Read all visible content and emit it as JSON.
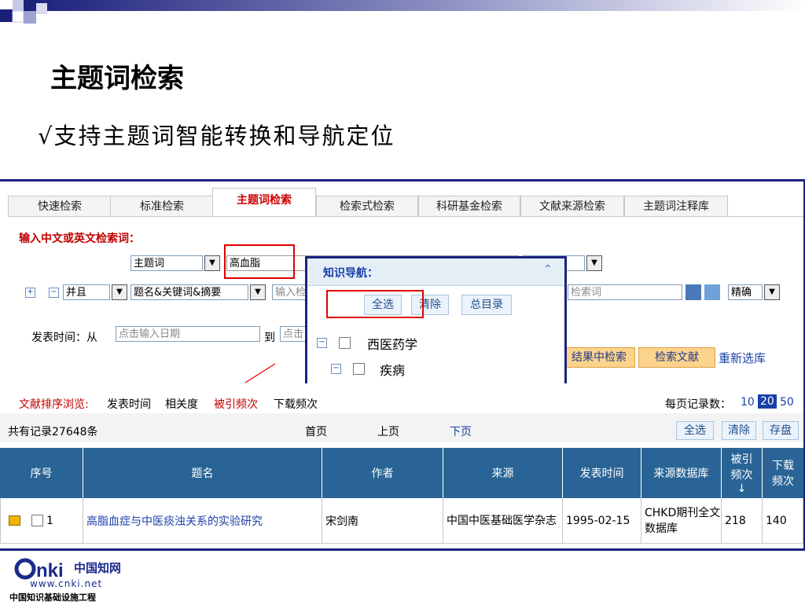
{
  "slide": {
    "title": "主题词检索",
    "subtitle": "√支持主题词智能转换和导航定位"
  },
  "tabs": [
    {
      "label": "快速检索",
      "active": false
    },
    {
      "label": "标准检索",
      "active": false
    },
    {
      "label": "主题词检索",
      "active": true
    },
    {
      "label": "检索式检索",
      "active": false
    },
    {
      "label": "科研基金检索",
      "active": false
    },
    {
      "label": "文献来源检索",
      "active": false
    },
    {
      "label": "主题词注释库",
      "active": false
    }
  ],
  "search": {
    "prompt": "输入中文或英文检索词：",
    "field_select": "主题词",
    "term_value": "高血脂",
    "logic_select": "并且",
    "field2_select": "题名&关键词&摘要",
    "input2_placeholder": "输入检",
    "keyword_placeholder": "检索词",
    "precision_select": "精确",
    "date_label": "发表时间：从",
    "date_from_placeholder": "点击输入日期",
    "date_to_label": "到",
    "date_to_placeholder": "点击",
    "btn_in_results": "结果中检索",
    "btn_search": "检索文献",
    "reselect_link": "重新选库"
  },
  "knowledge_nav": {
    "title": "知识导航：",
    "btn_select_all": "全选",
    "btn_clear": "清除",
    "btn_catalog": "总目录",
    "tree": [
      {
        "label": "西医药学",
        "level": 0
      },
      {
        "label": "疾病",
        "level": 1
      }
    ]
  },
  "results": {
    "sort_label": "文献排序浏览:",
    "sort_options": [
      "发表时间",
      "相关度",
      "被引频次",
      "下载频次"
    ],
    "active_sort": "被引频次",
    "per_page_label": "每页记录数：",
    "per_page_options": [
      "10",
      "20",
      "50"
    ],
    "active_per_page": "20",
    "total": "共有记录27648条",
    "pager": {
      "first": "首页",
      "prev": "上页",
      "next": "下页"
    },
    "actions": {
      "select_all": "全选",
      "clear": "清除",
      "save": "存盘"
    },
    "columns": [
      "序号",
      "题名",
      "作者",
      "来源",
      "发表时间",
      "来源数据库",
      "被引频次↓",
      "下载频次"
    ],
    "rows": [
      {
        "index": "1",
        "title": "高脂血症与中医痰浊关系的实验研究",
        "author": "宋剑南",
        "source": "中国中医基础医学杂志",
        "date": "1995-02-15",
        "db": "CHKD期刊全文数据库",
        "cited": "218",
        "downloads": "140"
      }
    ]
  },
  "logo": {
    "text_cn": "中国知网",
    "url": "www.cnki.net",
    "tagline": "中国知识基础设施工程"
  },
  "colors": {
    "frame": "#1a237e",
    "header_bg": "#2a6496",
    "accent_red": "#c00000",
    "button_orange": "#fbd38d"
  }
}
